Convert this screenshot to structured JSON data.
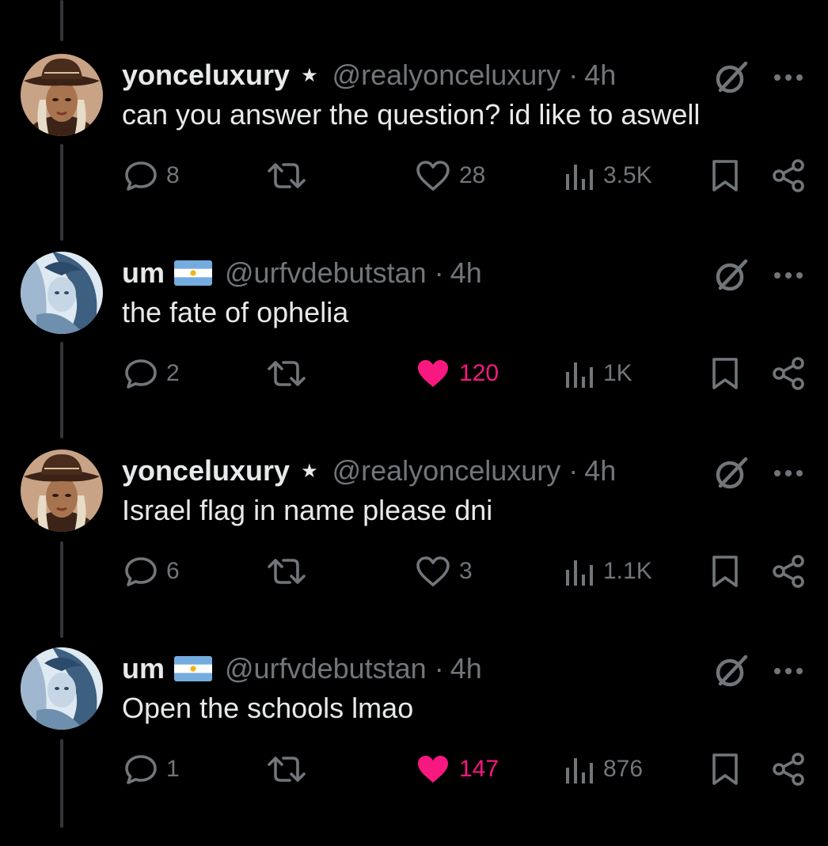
{
  "colors": {
    "background": "#000000",
    "primary_text": "#e7e9ea",
    "secondary_text": "#71767b",
    "like_active": "#f91880",
    "thread_line": "#333639"
  },
  "tweets": [
    {
      "display_name": "yonceluxury",
      "badge": "★",
      "handle": "@realyonceluxury",
      "separator": "·",
      "time": "4h",
      "text": "can you answer the question? id like to aswell",
      "avatar": "cowboy-hat-avatar",
      "name_flag": "",
      "stats": {
        "replies": "8",
        "likes": "28",
        "views": "3.5K"
      },
      "liked": false
    },
    {
      "display_name": "um",
      "badge": "",
      "handle": "@urfvdebutstan",
      "separator": "·",
      "time": "4h",
      "text": "the fate of ophelia",
      "avatar": "blue-portrait-avatar",
      "name_flag": "argentina-flag",
      "stats": {
        "replies": "2",
        "likes": "120",
        "views": "1K"
      },
      "liked": true
    },
    {
      "display_name": "yonceluxury",
      "badge": "★",
      "handle": "@realyonceluxury",
      "separator": "·",
      "time": "4h",
      "text": "Israel flag in name please dni",
      "avatar": "cowboy-hat-avatar",
      "name_flag": "",
      "stats": {
        "replies": "6",
        "likes": "3",
        "views": "1.1K"
      },
      "liked": false
    },
    {
      "display_name": "um",
      "badge": "",
      "handle": "@urfvdebutstan",
      "separator": "·",
      "time": "4h",
      "text": "Open the schools lmao",
      "avatar": "blue-portrait-avatar",
      "name_flag": "argentina-flag",
      "stats": {
        "replies": "1",
        "likes": "147",
        "views": "876"
      },
      "liked": true
    }
  ]
}
